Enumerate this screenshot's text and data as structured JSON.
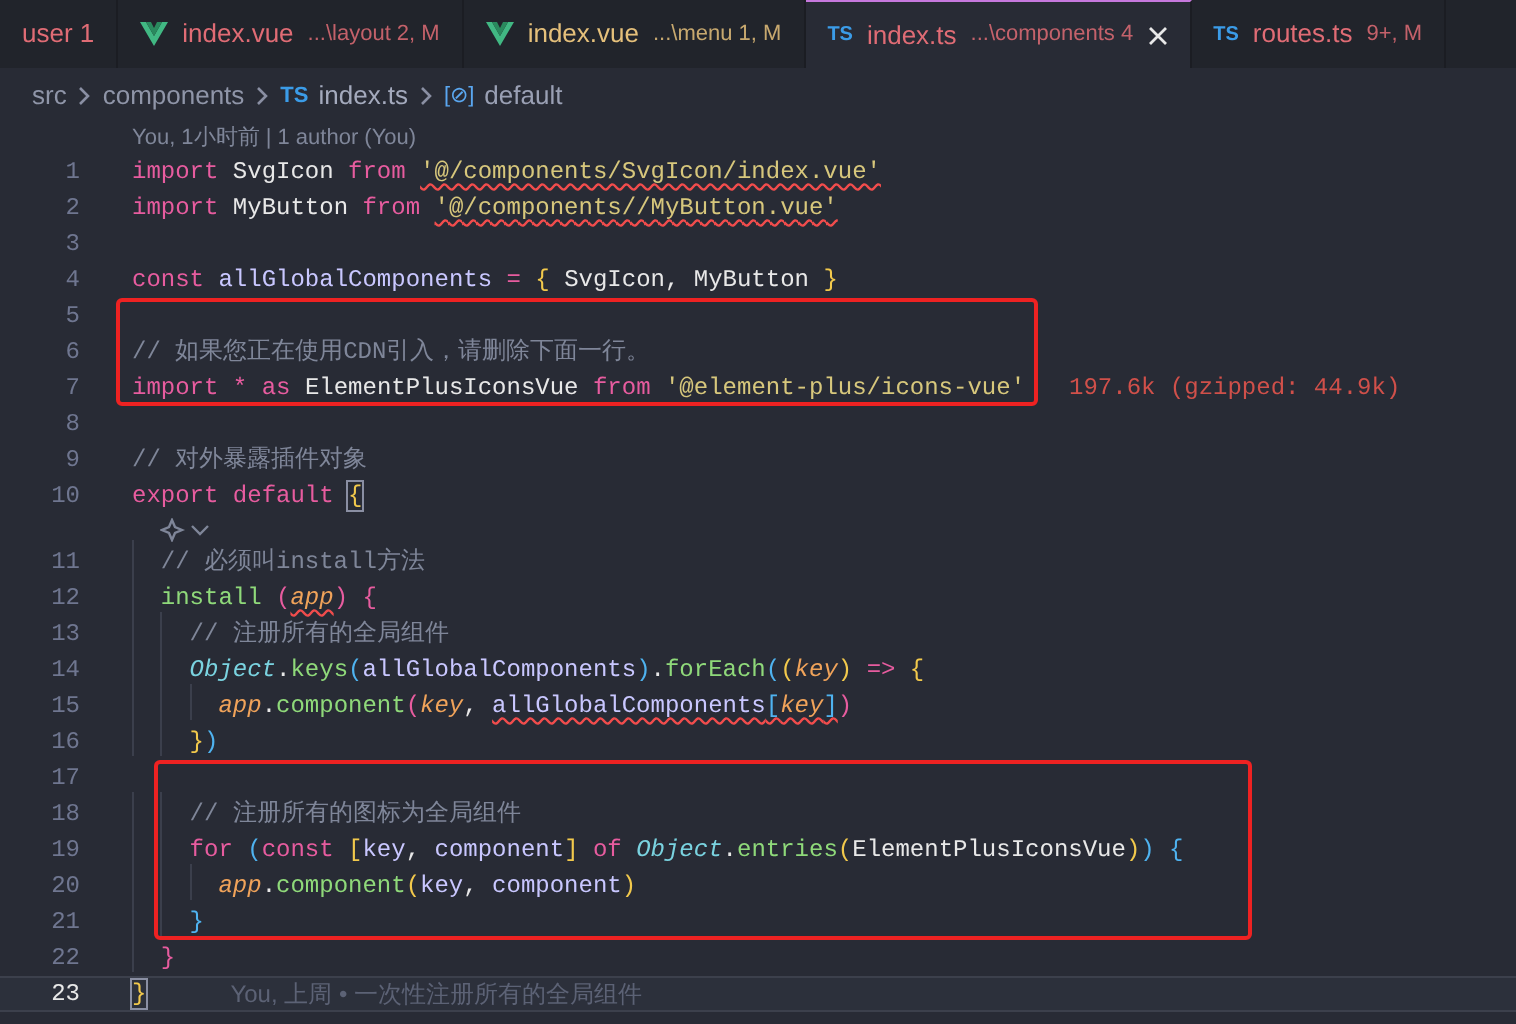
{
  "tabs": [
    {
      "kind": "plain",
      "name": "user 1",
      "color": "#e06c75",
      "selected": false
    },
    {
      "kind": "vue",
      "name": "index.vue",
      "path": "...\\layout 2, M",
      "color": "#e06c75",
      "selected": false
    },
    {
      "kind": "vue",
      "name": "index.vue",
      "path": "...\\menu 1, M",
      "color": "#e5c07b",
      "selected": false
    },
    {
      "kind": "ts",
      "badge": "TS",
      "name": "index.ts",
      "path": "...\\components 4",
      "color": "#e06c75",
      "selected": true
    },
    {
      "kind": "ts",
      "badge": "TS",
      "name": "routes.ts",
      "path": "9+, M",
      "color": "#e06c75",
      "selected": false
    }
  ],
  "breadcrumb": [
    {
      "kind": "folder",
      "text": "src"
    },
    {
      "kind": "folder",
      "text": "components"
    },
    {
      "kind": "file",
      "badge": "TS",
      "text": "index.ts"
    },
    {
      "kind": "symbol",
      "badge": "[⊘]",
      "text": "default"
    }
  ],
  "lines": [
    {
      "kind": "lens",
      "text": "You, 1小时前 | 1 author (You)"
    },
    {
      "kind": "code",
      "number": "1",
      "tokens": [
        {
          "text": "import ",
          "kind": "keyword"
        },
        {
          "text": "SvgIcon ",
          "kind": "plain"
        },
        {
          "text": "from ",
          "kind": "keyword"
        },
        {
          "text": "'@/components/SvgIcon/index.vue'",
          "kind": "string",
          "error": true
        }
      ]
    },
    {
      "kind": "code",
      "number": "2",
      "tokens": [
        {
          "text": "import ",
          "kind": "keyword"
        },
        {
          "text": "MyButton ",
          "kind": "plain"
        },
        {
          "text": "from ",
          "kind": "keyword"
        },
        {
          "text": "'@/components//MyButton.vue'",
          "kind": "string",
          "error": true
        }
      ]
    },
    {
      "kind": "code",
      "number": "3"
    },
    {
      "kind": "code",
      "number": "4",
      "tokens": [
        {
          "text": "const ",
          "kind": "keyword"
        },
        {
          "text": "allGlobalComponents ",
          "kind": "variable"
        },
        {
          "text": "= ",
          "kind": "operator"
        },
        {
          "text": "{ ",
          "kind": "bracket1"
        },
        {
          "text": "SvgIcon, MyButton ",
          "kind": "plain"
        },
        {
          "text": "}",
          "kind": "bracket1"
        }
      ]
    },
    {
      "kind": "box",
      "children": [
        {
          "kind": "code",
          "number": "5"
        },
        {
          "kind": "code",
          "number": "6",
          "tokens": [
            {
              "text": "// 如果您正在使用CDN引入，请删除下面一行。",
              "kind": "comment"
            }
          ]
        },
        {
          "kind": "code",
          "number": "7",
          "tokens": [
            {
              "text": "import ",
              "kind": "keyword"
            },
            {
              "text": "* ",
              "kind": "operator"
            },
            {
              "text": "as ",
              "kind": "keyword"
            },
            {
              "text": "ElementPlusIconsVue ",
              "kind": "plain"
            },
            {
              "text": "from ",
              "kind": "keyword"
            },
            {
              "text": "'@element-plus/icons-vue'",
              "kind": "string"
            }
          ],
          "size_note": "197.6k (gzipped: 44.9k)"
        }
      ]
    },
    {
      "kind": "code",
      "number": "8"
    },
    {
      "kind": "code",
      "number": "9",
      "tokens": [
        {
          "text": "// 对外暴露插件对象",
          "kind": "comment"
        }
      ]
    },
    {
      "kind": "code",
      "number": "10",
      "tokens": [
        {
          "text": "export ",
          "kind": "keyword"
        },
        {
          "text": "default ",
          "kind": "keyword"
        },
        {
          "text": "{",
          "kind": "bracket1",
          "matched": true
        }
      ]
    },
    {
      "kind": "lens_icon"
    },
    {
      "kind": "code",
      "number": "11",
      "tokens": [
        {
          "text": "  // 必须叫install方法",
          "kind": "comment"
        }
      ]
    },
    {
      "kind": "code",
      "number": "12",
      "tokens": [
        {
          "text": "  install ",
          "kind": "function"
        },
        {
          "text": "(",
          "kind": "bracket2"
        },
        {
          "text": "app",
          "kind": "parameter",
          "error": true
        },
        {
          "text": ") {",
          "kind": "bracket2"
        }
      ]
    },
    {
      "kind": "code",
      "number": "13",
      "tokens": [
        {
          "text": "    // 注册所有的全局组件",
          "kind": "comment"
        }
      ]
    },
    {
      "kind": "code",
      "number": "14",
      "tokens": [
        {
          "text": "    Object",
          "kind": "class"
        },
        {
          "text": ".",
          "kind": "plain"
        },
        {
          "text": "keys",
          "kind": "function"
        },
        {
          "text": "(",
          "kind": "bracket3"
        },
        {
          "text": "allGlobalComponents",
          "kind": "variable"
        },
        {
          "text": ")",
          "kind": "bracket3"
        },
        {
          "text": ".",
          "kind": "plain"
        },
        {
          "text": "forEach",
          "kind": "function"
        },
        {
          "text": "(",
          "kind": "bracket3"
        },
        {
          "text": "(",
          "kind": "bracket1"
        },
        {
          "text": "key",
          "kind": "parameter"
        },
        {
          "text": ") ",
          "kind": "bracket1"
        },
        {
          "text": "=> ",
          "kind": "operator"
        },
        {
          "text": "{",
          "kind": "bracket1"
        }
      ]
    },
    {
      "kind": "code",
      "number": "15",
      "tokens": [
        {
          "text": "      app",
          "kind": "parameter"
        },
        {
          "text": ".",
          "kind": "plain"
        },
        {
          "text": "component",
          "kind": "function"
        },
        {
          "text": "(",
          "kind": "bracket2"
        },
        {
          "text": "key",
          "kind": "parameter"
        },
        {
          "text": ", ",
          "kind": "plain"
        },
        {
          "text": "allGlobalComponents",
          "kind": "variable",
          "error": true
        },
        {
          "text": "[",
          "kind": "bracket3",
          "error": true
        },
        {
          "text": "key",
          "kind": "parameter",
          "error": true
        },
        {
          "text": "]",
          "kind": "bracket3",
          "error": true
        },
        {
          "text": ")",
          "kind": "bracket2"
        }
      ]
    },
    {
      "kind": "code",
      "number": "16",
      "tokens": [
        {
          "text": "    }",
          "kind": "bracket1"
        },
        {
          "text": ")",
          "kind": "bracket3"
        }
      ]
    },
    {
      "kind": "box",
      "children": [
        {
          "kind": "code",
          "number": "17"
        },
        {
          "kind": "code",
          "number": "18",
          "tokens": [
            {
              "text": "    // 注册所有的图标为全局组件",
              "kind": "comment"
            }
          ]
        },
        {
          "kind": "code",
          "number": "19",
          "tokens": [
            {
              "text": "    for ",
              "kind": "keyword"
            },
            {
              "text": "(",
              "kind": "bracket3"
            },
            {
              "text": "const ",
              "kind": "keyword"
            },
            {
              "text": "[",
              "kind": "bracket1"
            },
            {
              "text": "key",
              "kind": "variable"
            },
            {
              "text": ", ",
              "kind": "plain"
            },
            {
              "text": "component",
              "kind": "variable"
            },
            {
              "text": "] ",
              "kind": "bracket1"
            },
            {
              "text": "of ",
              "kind": "keyword"
            },
            {
              "text": "Object",
              "kind": "class"
            },
            {
              "text": ".",
              "kind": "plain"
            },
            {
              "text": "entries",
              "kind": "function"
            },
            {
              "text": "(",
              "kind": "bracket1"
            },
            {
              "text": "ElementPlusIconsVue",
              "kind": "plain"
            },
            {
              "text": ")",
              "kind": "bracket1"
            },
            {
              "text": ") {",
              "kind": "bracket3"
            }
          ]
        },
        {
          "kind": "code",
          "number": "20",
          "tokens": [
            {
              "text": "      app",
              "kind": "parameter"
            },
            {
              "text": ".",
              "kind": "plain"
            },
            {
              "text": "component",
              "kind": "function"
            },
            {
              "text": "(",
              "kind": "bracket1"
            },
            {
              "text": "key",
              "kind": "variable"
            },
            {
              "text": ", ",
              "kind": "plain"
            },
            {
              "text": "component",
              "kind": "variable"
            },
            {
              "text": ")",
              "kind": "bracket1"
            }
          ]
        },
        {
          "kind": "code",
          "number": "21",
          "tokens": [
            {
              "text": "    }",
              "kind": "bracket3"
            }
          ]
        }
      ]
    },
    {
      "kind": "code",
      "number": "22",
      "tokens": [
        {
          "text": "  }",
          "kind": "bracket2"
        }
      ]
    },
    {
      "kind": "code",
      "number": "23",
      "current": true,
      "tokens": [
        {
          "text": "}",
          "kind": "bracket1",
          "matched": true
        }
      ],
      "blame": "You, 上周 • 一次性注册所有的全局组件"
    }
  ]
}
